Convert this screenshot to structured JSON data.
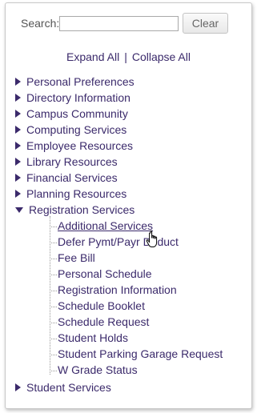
{
  "search": {
    "label": "Search:",
    "value": "",
    "placeholder": "",
    "clear_label": "Clear"
  },
  "controls": {
    "expand_all": "Expand All",
    "separator": "|",
    "collapse_all": "Collapse All"
  },
  "menu": {
    "items": [
      {
        "label": "Personal Preferences",
        "expanded": false
      },
      {
        "label": "Directory Information",
        "expanded": false
      },
      {
        "label": "Campus Community",
        "expanded": false
      },
      {
        "label": "Computing Services",
        "expanded": false
      },
      {
        "label": "Employee Resources",
        "expanded": false
      },
      {
        "label": "Library Resources",
        "expanded": false
      },
      {
        "label": "Financial Services",
        "expanded": false
      },
      {
        "label": "Planning Resources",
        "expanded": false
      },
      {
        "label": "Registration Services",
        "expanded": true
      },
      {
        "label": "Student Services",
        "expanded": false
      }
    ],
    "registration_children": [
      "Additional Services",
      "Defer Pymt/Payr Deduct",
      "Fee Bill",
      "Personal Schedule",
      "Registration Information",
      "Schedule Booklet",
      "Schedule Request",
      "Student Holds",
      "Student Parking Garage Request",
      "W Grade Status"
    ],
    "hovered_child": "Additional Services"
  },
  "colors": {
    "link": "#3b2a6b",
    "label": "#555555",
    "tree_line": "#9a9a9a"
  },
  "icons": {
    "collapsed": "triangle-right-icon",
    "expanded": "triangle-down-icon",
    "cursor": "hand-pointer-icon"
  }
}
